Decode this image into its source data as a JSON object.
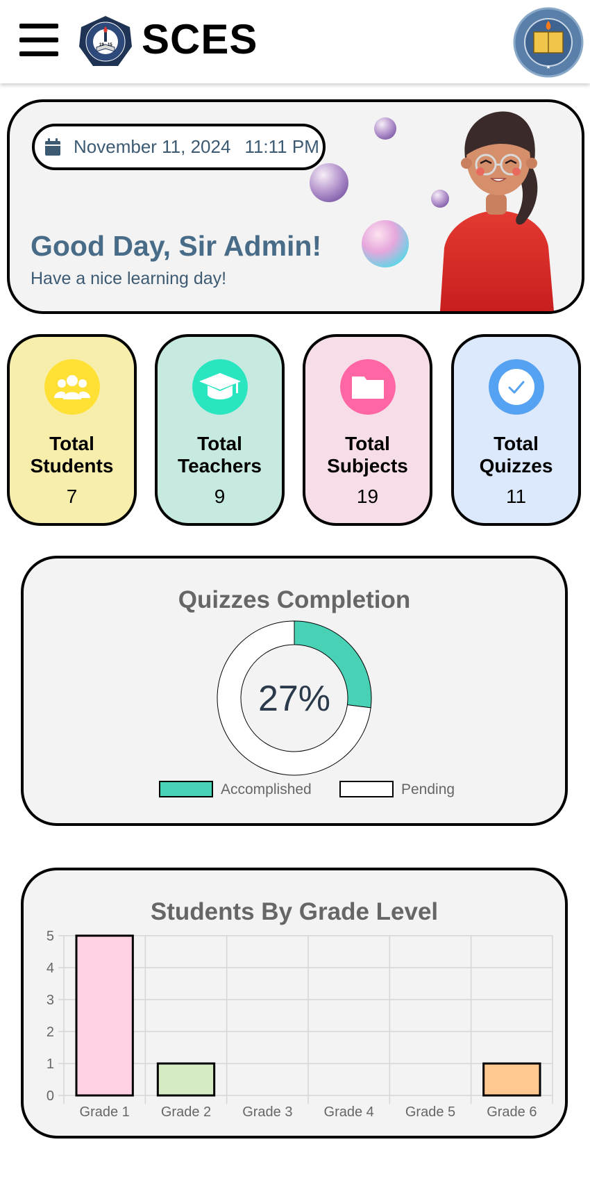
{
  "header": {
    "brand": "SCES",
    "menu_icon": "hamburger-menu-icon",
    "logo_text_top": "STA. CLARA ELEMENTARY SCHOOL",
    "logo_text_bottom": "BATANGAS CITY",
    "logo_year": "1915",
    "seal_text": "PAARALANG ELEMENTARYA NG STA. CLARA"
  },
  "welcome": {
    "date": "November 11, 2024",
    "time": "11:11 PM",
    "greeting": "Good Day, Sir Admin!",
    "subtitle": "Have a nice learning day!"
  },
  "stats": [
    {
      "label_line1": "Total",
      "label_line2": "Students",
      "value": "7",
      "icon": "users-icon",
      "bg": "#f8eeac",
      "icon_color": "#ffe135"
    },
    {
      "label_line1": "Total",
      "label_line2": "Teachers",
      "value": "9",
      "icon": "graduation-cap-icon",
      "bg": "#c6e9e0",
      "icon_color": "#29e5c0"
    },
    {
      "label_line1": "Total",
      "label_line2": "Subjects",
      "value": "19",
      "icon": "folder-icon",
      "bg": "#f7dde8",
      "icon_color": "#ff66a3"
    },
    {
      "label_line1": "Total",
      "label_line2": "Quizzes",
      "value": "11",
      "icon": "check-circle-icon",
      "bg": "#dce8fb",
      "icon_color": "#56a2f2"
    }
  ],
  "chart_data": [
    {
      "type": "doughnut",
      "title": "Quizzes Completion",
      "center_label": "27%",
      "categories": [
        "Accomplished",
        "Pending"
      ],
      "values": [
        27,
        73
      ],
      "colors": [
        "#48d1b4",
        "#ffffff"
      ],
      "legend": "bottom"
    },
    {
      "type": "bar",
      "title": "Students By Grade Level",
      "categories": [
        "Grade 1",
        "Grade 2",
        "Grade 3",
        "Grade 4",
        "Grade 5",
        "Grade 6"
      ],
      "values": [
        5,
        1,
        0,
        0,
        0,
        1
      ],
      "ylim": [
        0,
        5
      ],
      "yticks": [
        "0",
        "1",
        "2",
        "3",
        "4",
        "5"
      ],
      "colors": [
        "#ffd1e3",
        "#d4ebc4",
        "#cfe8f5",
        "#e6d9f5",
        "#fff2b3",
        "#ffc891"
      ],
      "grid": true
    }
  ]
}
